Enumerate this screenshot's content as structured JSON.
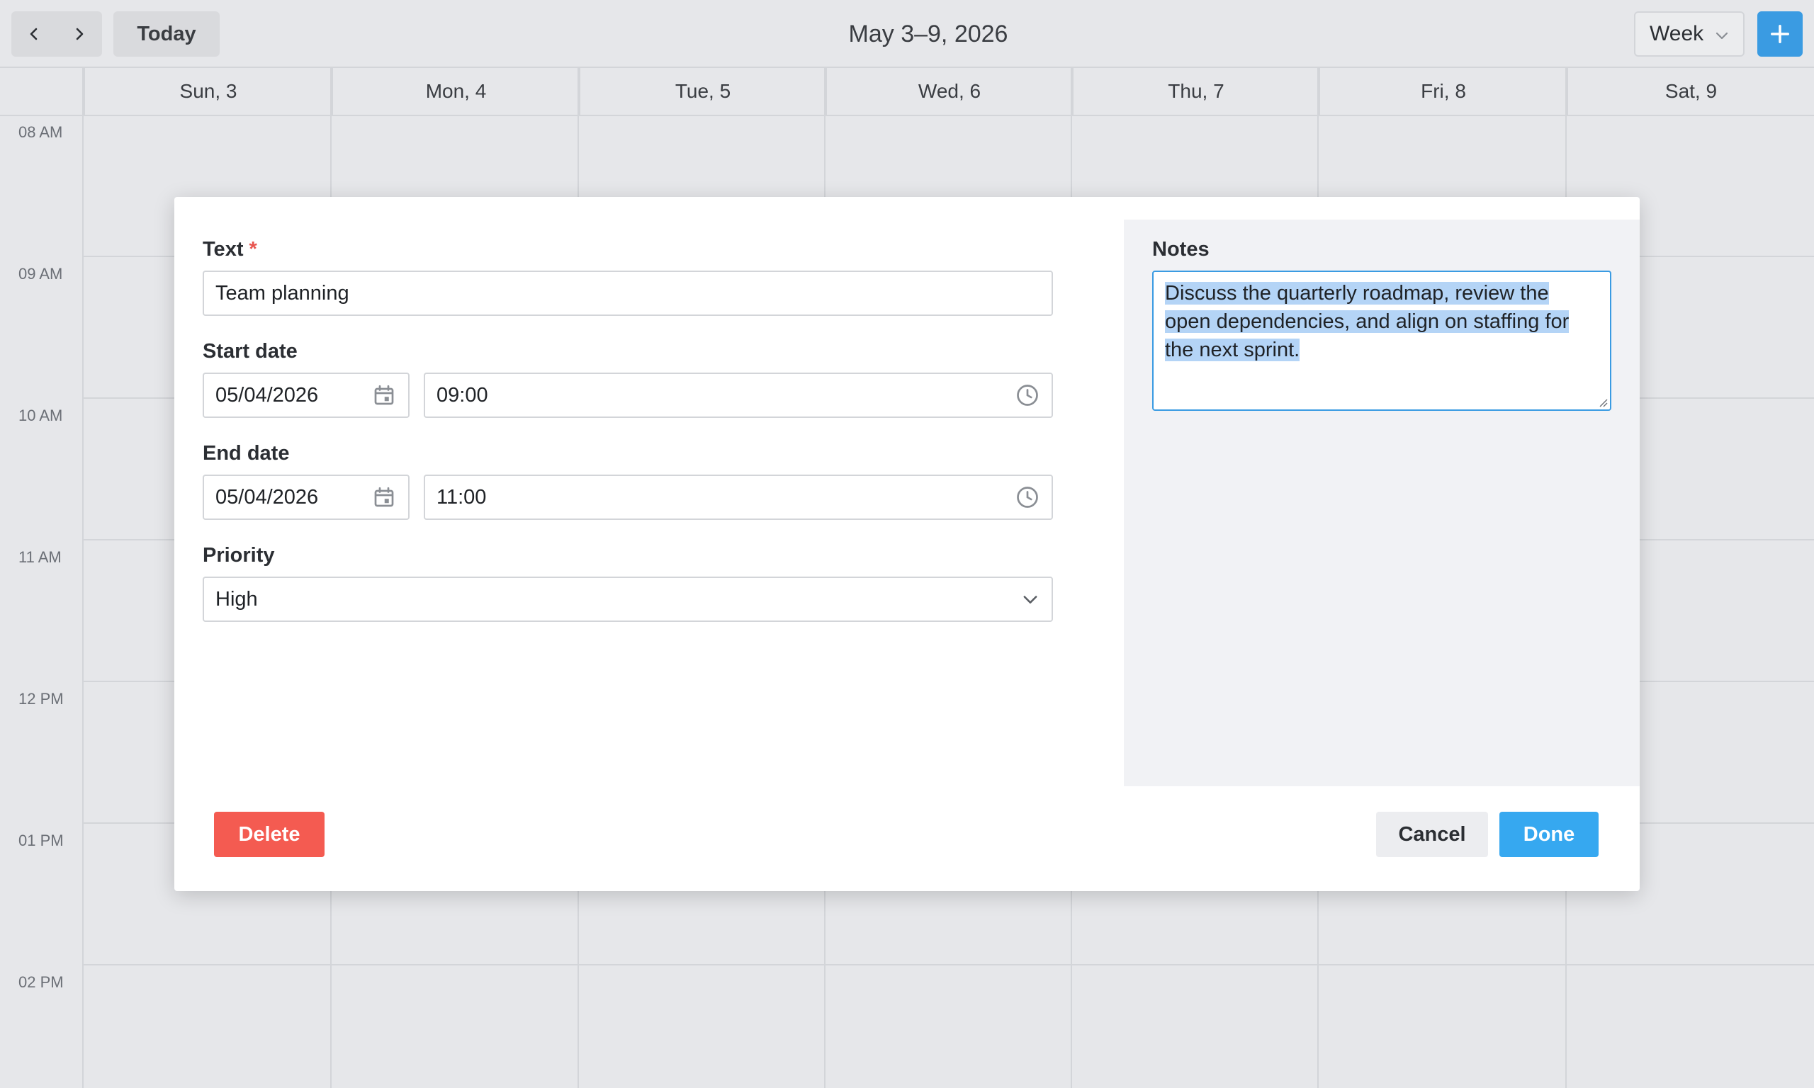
{
  "toolbar": {
    "today_label": "Today",
    "date_range": "May 3–9, 2026",
    "view_label": "Week",
    "accent_color": "#3a9be2"
  },
  "days": [
    {
      "label": "Sun, 3"
    },
    {
      "label": "Mon, 4"
    },
    {
      "label": "Tue, 5"
    },
    {
      "label": "Wed, 6"
    },
    {
      "label": "Thu, 7"
    },
    {
      "label": "Fri, 8"
    },
    {
      "label": "Sat, 9"
    }
  ],
  "hours": [
    "08 AM",
    "09 AM",
    "10 AM",
    "11 AM",
    "12 PM",
    "01 PM",
    "02 PM"
  ],
  "dialog": {
    "text_label": "Text",
    "required_mark": "*",
    "text_value": "Team planning",
    "start_label": "Start date",
    "start_date": "05/04/2026",
    "start_time": "09:00",
    "end_label": "End date",
    "end_date": "05/04/2026",
    "end_time": "11:00",
    "priority_label": "Priority",
    "priority_value": "High",
    "notes_label": "Notes",
    "notes_value": "Discuss the quarterly roadmap, review the open dependencies, and align on staffing for the next sprint.",
    "delete_label": "Delete",
    "cancel_label": "Cancel",
    "done_label": "Done",
    "delete_color": "#f45b51",
    "done_color": "#36a8f0"
  }
}
